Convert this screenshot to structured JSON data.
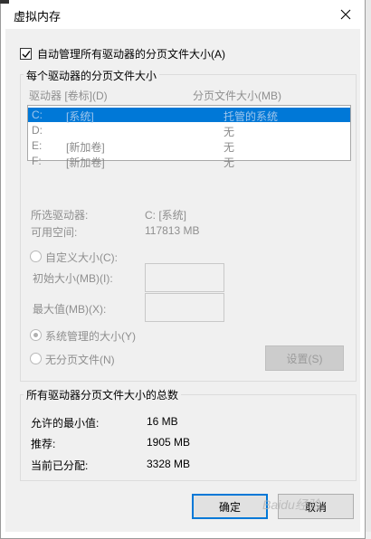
{
  "window": {
    "title": "虚拟内存"
  },
  "auto_manage": {
    "label": "自动管理所有驱动器的分页文件大小(A)",
    "checked": true
  },
  "per_drive": {
    "group_label": "每个驱动器的分页文件大小",
    "col_drive": "驱动器 [卷标](D)",
    "col_size": "分页文件大小(MB)",
    "rows": [
      {
        "drive": "C:",
        "label": "[系统]",
        "size": "托管的系统",
        "selected": true
      },
      {
        "drive": "D:",
        "label": "",
        "size": "无",
        "selected": false
      },
      {
        "drive": "E:",
        "label": "[新加卷]",
        "size": "无",
        "selected": false
      },
      {
        "drive": "F:",
        "label": "[新加卷]",
        "size": "无",
        "selected": false
      }
    ],
    "selected_drive_label": "所选驱动器:",
    "selected_drive_value": "C:  [系统]",
    "available_space_label": "可用空间:",
    "available_space_value": "117813 MB",
    "custom_size_label": "自定义大小(C):",
    "initial_size_label": "初始大小(MB)(I):",
    "max_size_label": "最大值(MB)(X):",
    "system_managed_label": "系统管理的大小(Y)",
    "no_paging_label": "无分页文件(N)",
    "set_button": "设置(S)"
  },
  "totals": {
    "group_label": "所有驱动器分页文件大小的总数",
    "min_label": "允许的最小值:",
    "min_value": "16 MB",
    "recommended_label": "推荐:",
    "recommended_value": "1905 MB",
    "allocated_label": "当前已分配:",
    "allocated_value": "3328 MB"
  },
  "buttons": {
    "ok": "确定",
    "cancel": "取消"
  },
  "watermark": "Baidu经验"
}
